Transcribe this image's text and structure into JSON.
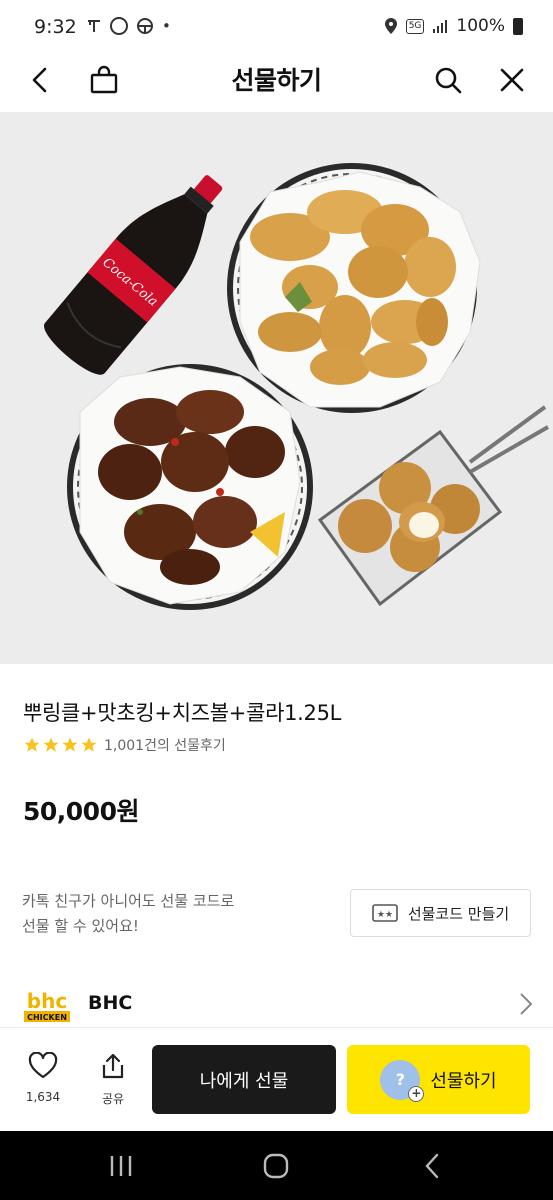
{
  "status_bar": {
    "time": "9:32",
    "dot": "•",
    "network": "5G",
    "battery": "100%",
    "icons": [
      "t-icon",
      "kakao-icon",
      "steering-icon",
      "location-icon",
      "wifi-icon",
      "signal-icon",
      "battery-icon"
    ]
  },
  "header": {
    "title": "선물하기",
    "icons": [
      "back-icon",
      "shopping-bag-icon",
      "search-icon",
      "close-icon"
    ]
  },
  "product": {
    "title": "뿌링클+맛초킹+치즈볼+콜라1.25L",
    "rating_stars": 4,
    "review_text": "1,001건의 선물후기",
    "price": "50,000원",
    "image_caption_cola": "Coca-Cola"
  },
  "gift_code": {
    "message_line1": "카톡 친구가 아니어도 선물 코드로",
    "message_line2": "선물 할 수 있어요!",
    "button_label": "선물코드 만들기"
  },
  "brand": {
    "logo_text_top": "bhc",
    "logo_text_bottom": "CHICKEN",
    "name": "BHC"
  },
  "bottom_bar": {
    "like_count": "1,634",
    "share_label": "공유",
    "gift_me_label": "나에게 선물",
    "gift_label": "선물하기",
    "avatar_glyph": "?",
    "avatar_plus": "+"
  },
  "colors": {
    "accent_yellow": "#fee500",
    "dark_button": "#1a1a1a",
    "star": "#f8c21a",
    "hero_bg": "#ececec"
  }
}
